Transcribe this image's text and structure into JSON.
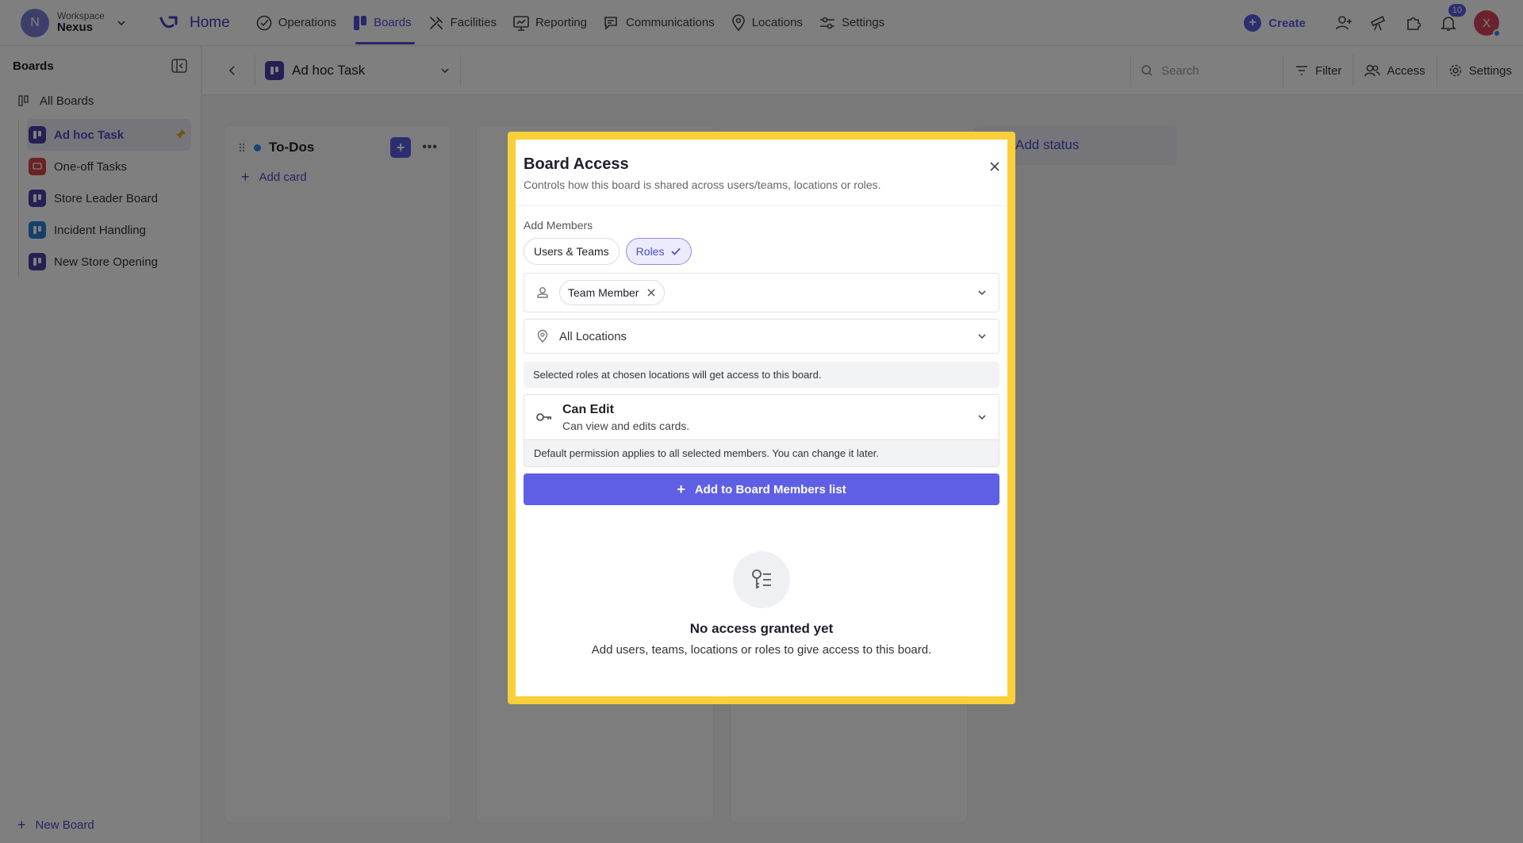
{
  "workspace": {
    "avatar_letter": "N",
    "label": "Workspace",
    "name": "Nexus"
  },
  "nav": {
    "home": "Home",
    "items": [
      "Operations",
      "Boards",
      "Facilities",
      "Reporting",
      "Communications",
      "Locations",
      "Settings"
    ],
    "create": "Create",
    "notifications_count": "10",
    "user_initial": "X"
  },
  "sidebar": {
    "title": "Boards",
    "all_boards": "All Boards",
    "items": [
      {
        "label": "Ad hoc Task",
        "color": "#4b3fa8"
      },
      {
        "label": "One-off Tasks",
        "color": "#d64545"
      },
      {
        "label": "Store Leader Board",
        "color": "#4b3fa8"
      },
      {
        "label": "Incident Handling",
        "color": "#2d7fd6"
      },
      {
        "label": "New Store Opening",
        "color": "#4b3fa8"
      }
    ],
    "new_board": "New Board"
  },
  "board_header": {
    "board_name": "Ad hoc Task",
    "search_placeholder": "Search",
    "filter": "Filter",
    "access": "Access",
    "settings": "Settings"
  },
  "board": {
    "column_title": "To-Dos",
    "add_card": "Add card",
    "add_status": "Add status"
  },
  "modal": {
    "title": "Board Access",
    "subtitle": "Controls how this board is shared across users/teams, locations or roles.",
    "add_members_label": "Add Members",
    "tabs": [
      "Users & Teams",
      "Roles"
    ],
    "role_chip": "Team Member",
    "location_value": "All Locations",
    "roles_hint": "Selected roles at chosen locations will get access to this board.",
    "permission_title": "Can Edit",
    "permission_sub": "Can view and edits cards.",
    "permission_hint": "Default permission applies to all selected members. You can change it later.",
    "add_button": "Add to Board Members list",
    "empty_title": "No access granted yet",
    "empty_sub": "Add users, teams, locations or roles to give access to this board."
  },
  "colors": {
    "accent": "#5f5fe6",
    "highlight_frame": "#f9cf3a"
  }
}
